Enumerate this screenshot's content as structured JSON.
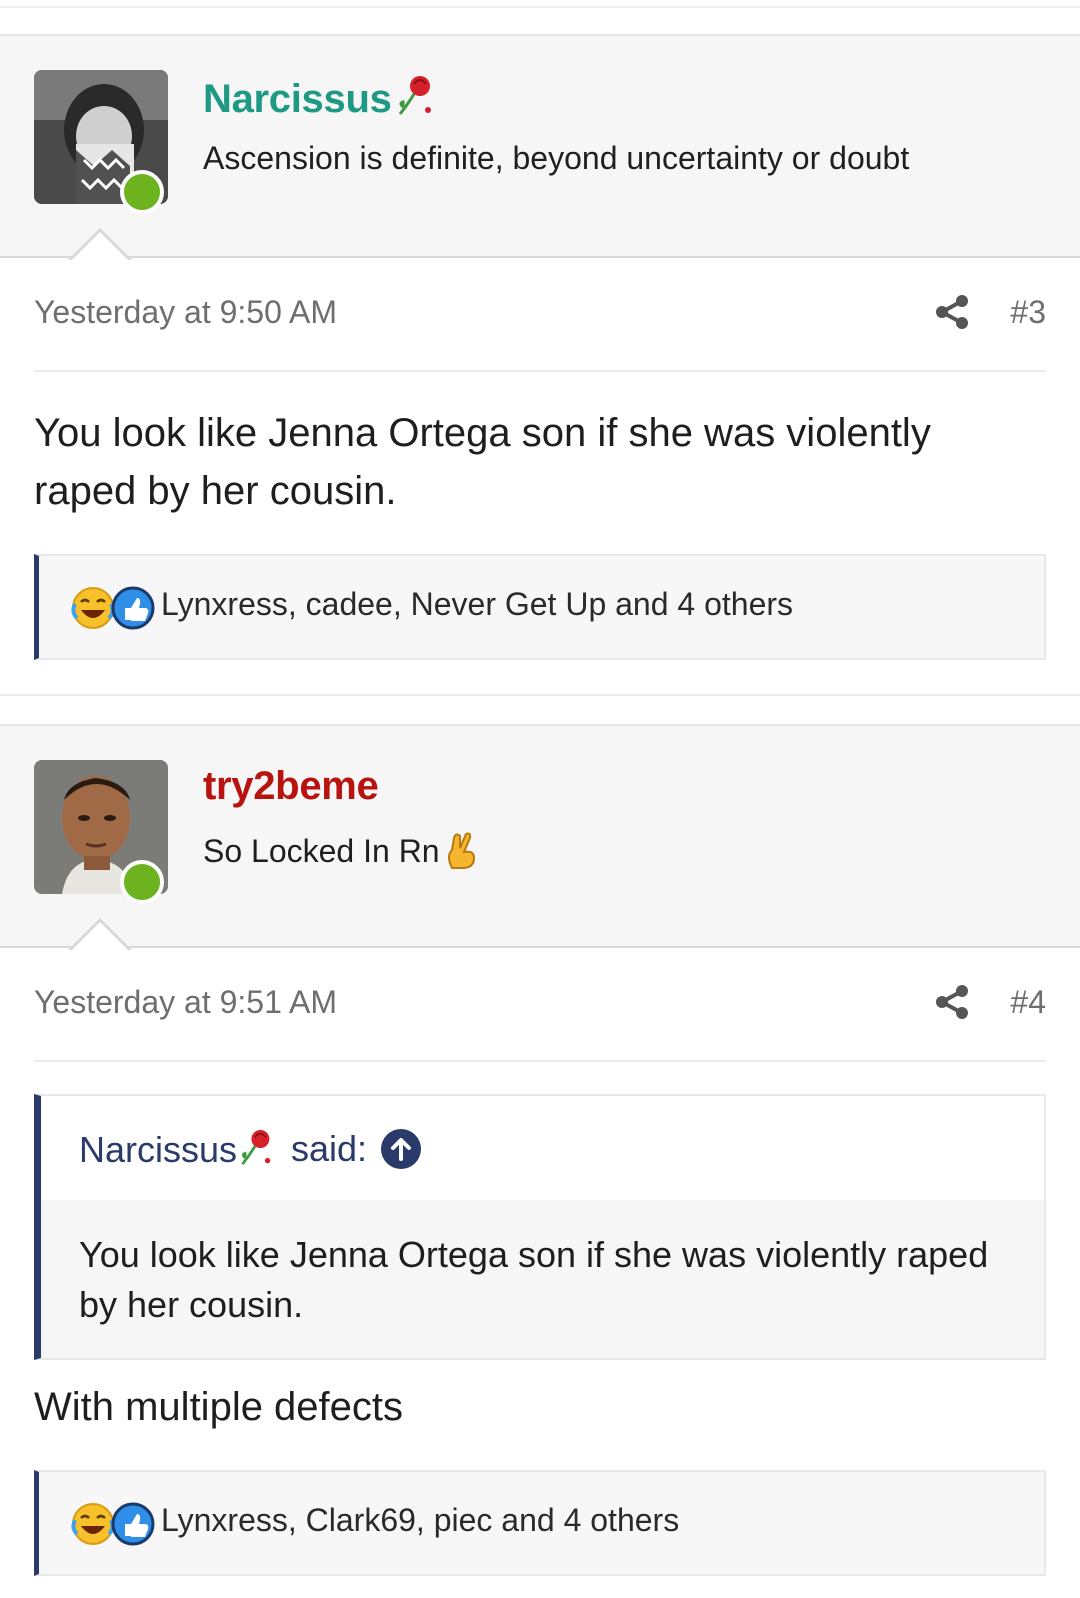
{
  "posts": [
    {
      "username": "Narcissus",
      "username_color": "#1e9a84",
      "user_title": "Ascension is definite, beyond uncertainty or doubt",
      "avatar": "narcissus-avatar",
      "date": "Yesterday at 9:50 AM",
      "post_number": "#3",
      "body": "You look like Jenna Ortega son if she was violently raped by her cousin.",
      "reactions": {
        "icons": [
          "laughing-emoji-icon",
          "like-thumb-icon"
        ],
        "names": "Lynxress, cadee, Never Get Up and 4 others"
      }
    },
    {
      "username": "try2beme",
      "username_color": "#b8130f",
      "user_title": "So Locked In Rn",
      "avatar": "try2beme-avatar",
      "date": "Yesterday at 9:51 AM",
      "post_number": "#4",
      "quote": {
        "author": "Narcissus",
        "said": "said:",
        "text": "You look like Jenna Ortega son if she was violently raped by her cousin."
      },
      "body": "With multiple defects",
      "reactions": {
        "icons": [
          "laughing-emoji-icon",
          "like-thumb-icon"
        ],
        "names": "Lynxress, Clark69, piec and 4 others"
      }
    }
  ],
  "colors": {
    "online": "#6cb31f",
    "quote_accent": "#2a3a6a"
  }
}
